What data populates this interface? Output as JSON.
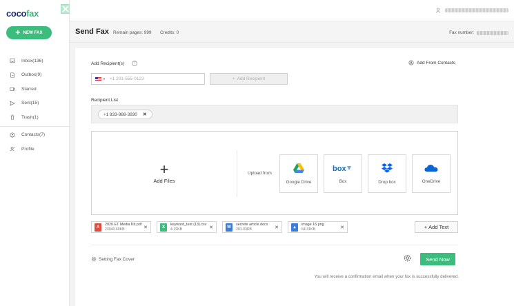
{
  "brand": {
    "logo_main": "coco",
    "logo_accent": "fax"
  },
  "sidebar": {
    "new_fax_label": "NEW FAX",
    "items": [
      {
        "label": "Inbox(136)",
        "icon": "inbox-icon"
      },
      {
        "label": "Outbox(9)",
        "icon": "outbox-icon"
      },
      {
        "label": "Starred",
        "icon": "starred-icon"
      },
      {
        "label": "Sent(15)",
        "icon": "sent-icon"
      },
      {
        "label": "Trash(1)",
        "icon": "trash-icon"
      },
      {
        "label": "Contacts(7)",
        "icon": "contacts-icon"
      },
      {
        "label": "Profile",
        "icon": "profile-icon"
      }
    ]
  },
  "header": {
    "title": "Send Fax",
    "remain": "Remain pages: 999",
    "credits": "Credits: 0",
    "fax_number_label": "Fax number:"
  },
  "form": {
    "add_recipients_label": "Add Recipient(s)",
    "add_from_contacts": "Add From Contacts",
    "phone_placeholder": "+1 201-555-0123",
    "add_recipient_button": "Add Recipient",
    "recipient_list_label": "Recipient List",
    "recipients": [
      "+1 833-988-3930"
    ]
  },
  "upload": {
    "add_files": "Add Files",
    "upload_from": "Upload from",
    "services": [
      "Google Drive",
      "Box",
      "Drop box",
      "OneDrive"
    ]
  },
  "files": [
    {
      "name": "2020 ET Media Kit.pdf",
      "size": "23940.69KB",
      "type": "pdf",
      "color": "#e34b3f"
    },
    {
      "name": "keyword_text (13).csv",
      "size": "4.19KB",
      "type": "csv",
      "color": "#3dbd7d"
    },
    {
      "name": "secrete article.docx",
      "size": "281.03KB",
      "type": "docx",
      "color": "#3b7ddd"
    },
    {
      "name": "image 16.png",
      "size": "64.31KB",
      "type": "png",
      "color": "#3b7ddd"
    }
  ],
  "add_text_button": "Add Text",
  "footer": {
    "setting_cover": "Setting Fax Cover",
    "send_now": "Send Now",
    "confirmation": "You will receive a confirmation email when your fax is successfully delivered."
  },
  "colors": {
    "brand_green": "#3dbd7d",
    "brand_navy": "#1a2d6b"
  }
}
